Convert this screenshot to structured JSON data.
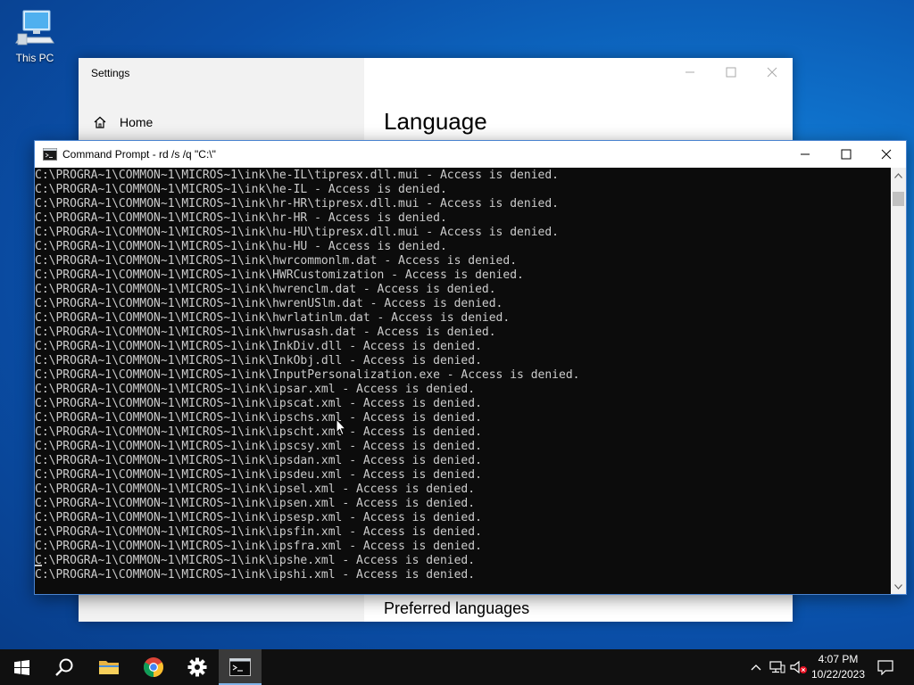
{
  "desktop": {
    "icons": [
      {
        "label": "This PC",
        "icon": "computer-icon"
      }
    ]
  },
  "settings": {
    "title": "Settings",
    "home_label": "Home",
    "heading": "Language",
    "preferred_label": "Preferred languages"
  },
  "cmd": {
    "title": "Command Prompt - rd  /s /q \"C:\\\"",
    "lines": [
      "C:\\PROGRA~1\\COMMON~1\\MICROS~1\\ink\\he-IL\\tipresx.dll.mui - Access is denied.",
      "C:\\PROGRA~1\\COMMON~1\\MICROS~1\\ink\\he-IL - Access is denied.",
      "C:\\PROGRA~1\\COMMON~1\\MICROS~1\\ink\\hr-HR\\tipresx.dll.mui - Access is denied.",
      "C:\\PROGRA~1\\COMMON~1\\MICROS~1\\ink\\hr-HR - Access is denied.",
      "C:\\PROGRA~1\\COMMON~1\\MICROS~1\\ink\\hu-HU\\tipresx.dll.mui - Access is denied.",
      "C:\\PROGRA~1\\COMMON~1\\MICROS~1\\ink\\hu-HU - Access is denied.",
      "C:\\PROGRA~1\\COMMON~1\\MICROS~1\\ink\\hwrcommonlm.dat - Access is denied.",
      "C:\\PROGRA~1\\COMMON~1\\MICROS~1\\ink\\HWRCustomization - Access is denied.",
      "C:\\PROGRA~1\\COMMON~1\\MICROS~1\\ink\\hwrenclm.dat - Access is denied.",
      "C:\\PROGRA~1\\COMMON~1\\MICROS~1\\ink\\hwrenUSlm.dat - Access is denied.",
      "C:\\PROGRA~1\\COMMON~1\\MICROS~1\\ink\\hwrlatinlm.dat - Access is denied.",
      "C:\\PROGRA~1\\COMMON~1\\MICROS~1\\ink\\hwrusash.dat - Access is denied.",
      "C:\\PROGRA~1\\COMMON~1\\MICROS~1\\ink\\InkDiv.dll - Access is denied.",
      "C:\\PROGRA~1\\COMMON~1\\MICROS~1\\ink\\InkObj.dll - Access is denied.",
      "C:\\PROGRA~1\\COMMON~1\\MICROS~1\\ink\\InputPersonalization.exe - Access is denied.",
      "C:\\PROGRA~1\\COMMON~1\\MICROS~1\\ink\\ipsar.xml - Access is denied.",
      "C:\\PROGRA~1\\COMMON~1\\MICROS~1\\ink\\ipscat.xml - Access is denied.",
      "C:\\PROGRA~1\\COMMON~1\\MICROS~1\\ink\\ipschs.xml - Access is denied.",
      "C:\\PROGRA~1\\COMMON~1\\MICROS~1\\ink\\ipscht.xml - Access is denied.",
      "C:\\PROGRA~1\\COMMON~1\\MICROS~1\\ink\\ipscsy.xml - Access is denied.",
      "C:\\PROGRA~1\\COMMON~1\\MICROS~1\\ink\\ipsdan.xml - Access is denied.",
      "C:\\PROGRA~1\\COMMON~1\\MICROS~1\\ink\\ipsdeu.xml - Access is denied.",
      "C:\\PROGRA~1\\COMMON~1\\MICROS~1\\ink\\ipsel.xml - Access is denied.",
      "C:\\PROGRA~1\\COMMON~1\\MICROS~1\\ink\\ipsen.xml - Access is denied.",
      "C:\\PROGRA~1\\COMMON~1\\MICROS~1\\ink\\ipsesp.xml - Access is denied.",
      "C:\\PROGRA~1\\COMMON~1\\MICROS~1\\ink\\ipsfin.xml - Access is denied.",
      "C:\\PROGRA~1\\COMMON~1\\MICROS~1\\ink\\ipsfra.xml - Access is denied.",
      "C:\\PROGRA~1\\COMMON~1\\MICROS~1\\ink\\ipshe.xml - Access is denied.",
      "C:\\PROGRA~1\\COMMON~1\\MICROS~1\\ink\\ipshi.xml - Access is denied."
    ]
  },
  "taskbar": {
    "apps": [
      {
        "name": "start-button",
        "icon": "windows-logo-icon"
      },
      {
        "name": "search-button",
        "icon": "search-icon"
      },
      {
        "name": "file-explorer-button",
        "icon": "folder-icon"
      },
      {
        "name": "chrome-button",
        "icon": "chrome-icon"
      },
      {
        "name": "settings-button",
        "icon": "gear-icon"
      },
      {
        "name": "command-prompt-button",
        "icon": "terminal-icon"
      }
    ],
    "clock": {
      "time": "4:07 PM",
      "date": "10/22/2023"
    }
  },
  "colors": {
    "taskbar_bg": "#101010",
    "console_bg": "#0c0c0c",
    "console_text": "#cccccc",
    "accent": "#0078d7"
  }
}
